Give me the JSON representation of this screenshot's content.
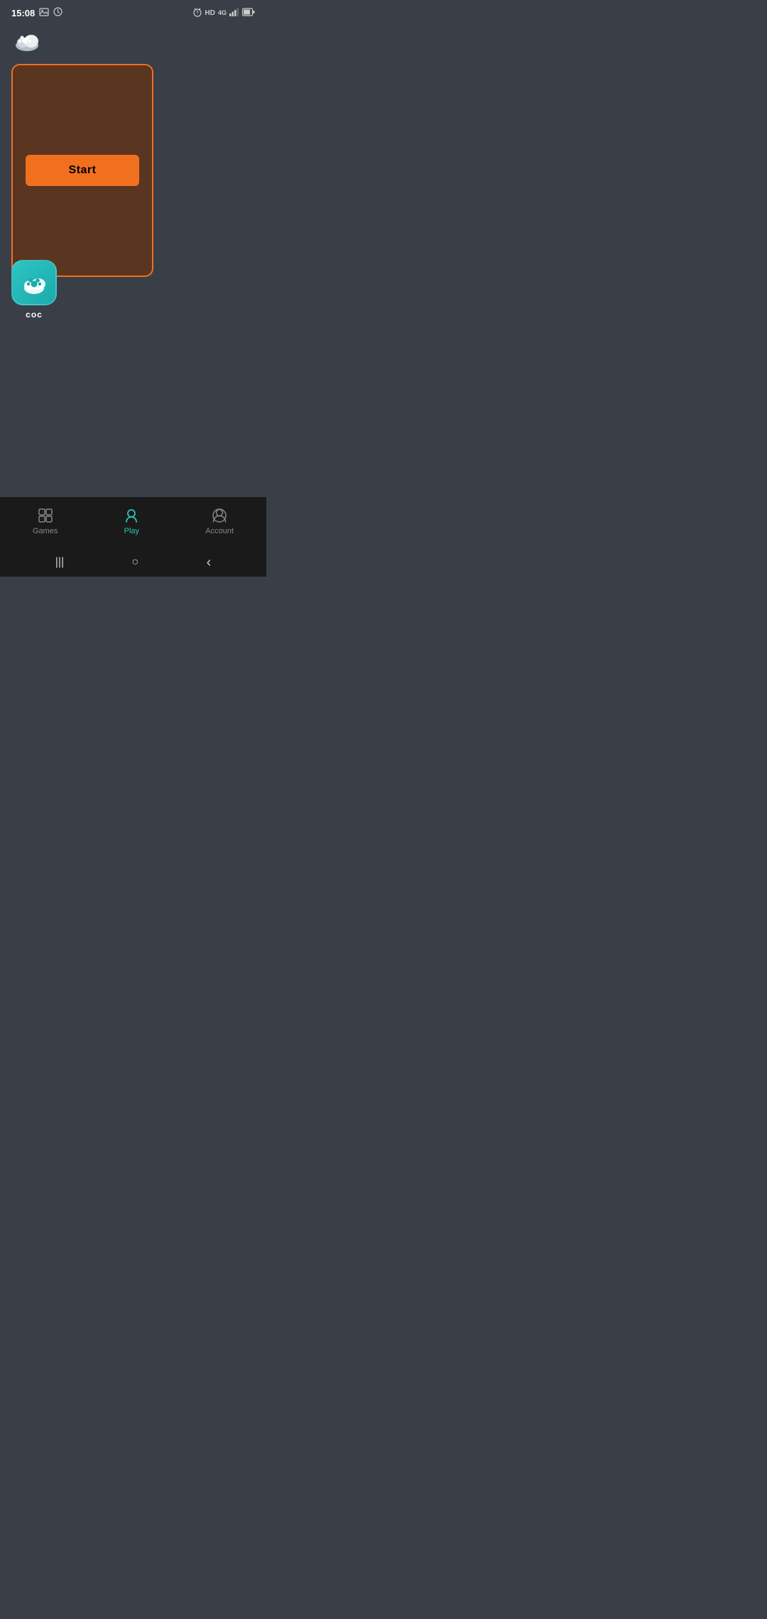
{
  "statusBar": {
    "time": "15:08",
    "icons": [
      "image",
      "clock",
      "alarm",
      "hd",
      "4g",
      "signal",
      "battery"
    ]
  },
  "appHeader": {
    "iconAlt": "paw-cloud"
  },
  "gameCard": {
    "startButtonLabel": "Start"
  },
  "gameIcon": {
    "label": "coc"
  },
  "bottomNav": {
    "items": [
      {
        "id": "games",
        "label": "Games",
        "active": false
      },
      {
        "id": "play",
        "label": "Play",
        "active": true
      },
      {
        "id": "account",
        "label": "Account",
        "active": false
      }
    ]
  },
  "systemNav": {
    "back": "‹",
    "home": "○",
    "recents": "|||"
  }
}
